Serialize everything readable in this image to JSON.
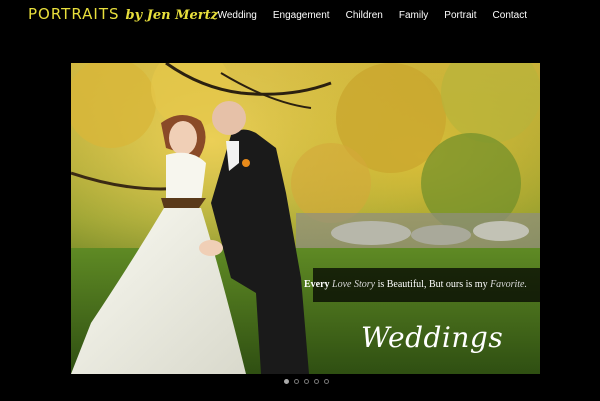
{
  "header": {
    "logo_main": "PORTRAITS",
    "logo_by": "by Jen Mertz"
  },
  "nav": {
    "items": [
      {
        "label": "Wedding"
      },
      {
        "label": "Engagement"
      },
      {
        "label": "Children"
      },
      {
        "label": "Family"
      },
      {
        "label": "Portrait"
      },
      {
        "label": "Contact"
      }
    ]
  },
  "slide": {
    "caption_every": "Every",
    "caption_love_story": "Love Story",
    "caption_mid": "is Beautiful, But ours is my",
    "caption_favorite": "Favorite.",
    "title": "Weddings"
  },
  "pagination": {
    "count": 5,
    "active_index": 0
  },
  "colors": {
    "background": "#000000",
    "logo": "#e8df3c",
    "nav_text": "#ffffff"
  }
}
